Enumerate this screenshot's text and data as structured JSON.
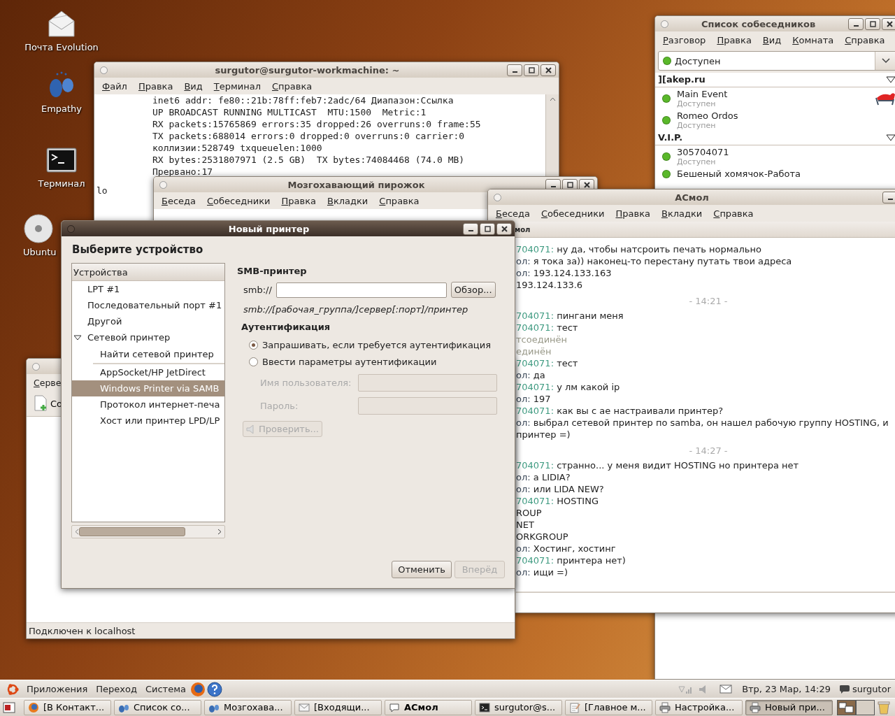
{
  "desktop_icons": [
    {
      "label": "Почта Evolution",
      "kind": "mail"
    },
    {
      "label": "Empathy",
      "kind": "people"
    },
    {
      "label": "Терминал",
      "kind": "terminal"
    },
    {
      "label": "Ubuntu",
      "kind": "disc"
    }
  ],
  "terminal_window": {
    "title": "surgutor@surgutor-workmachine: ~",
    "menu": [
      "Файл",
      "Правка",
      "Вид",
      "Терминал",
      "Справка"
    ],
    "lines": [
      {
        "kind": "detail",
        "text": "inet6 addr: fe80::21b:78ff:feb7:2adc/64 Диапазон:Ссылка"
      },
      {
        "kind": "detail",
        "text": "UP BROADCAST RUNNING MULTICAST  MTU:1500  Metric:1"
      },
      {
        "kind": "detail",
        "text": "RX packets:15765869 errors:35 dropped:26 overruns:0 frame:55"
      },
      {
        "kind": "detail",
        "text": "TX packets:688014 errors:0 dropped:0 overruns:0 carrier:0"
      },
      {
        "kind": "detail",
        "text": "коллизии:528749 txqueuelen:1000"
      },
      {
        "kind": "detail",
        "text": "RX bytes:2531807971 (2.5 GB)  TX bytes:74084468 (74.0 MB)"
      },
      {
        "kind": "detail",
        "text": "Прервано:17"
      },
      {
        "kind": "iface",
        "text": "lo"
      }
    ]
  },
  "contact_list_window": {
    "title": "Список собеседников",
    "menu": [
      "Разговор",
      "Правка",
      "Вид",
      "Комната",
      "Справка"
    ],
    "status": {
      "label": "Доступен",
      "color": "#5ab82a"
    },
    "groups": [
      {
        "name": "][akep.ru",
        "expanded": true,
        "contacts": [
          {
            "name": "Main Event",
            "status": "Доступен",
            "color": "#5ab82a",
            "has_avatar": true
          },
          {
            "name": "Romeo Ordos",
            "status": "Доступен",
            "color": "#5ab82a",
            "has_avatar": false
          }
        ]
      },
      {
        "name": "V.I.P.",
        "expanded": true,
        "contacts": [
          {
            "name": "305704071",
            "status": "Доступен",
            "color": "#5ab82a",
            "has_avatar": false
          },
          {
            "name": "Бешеный хомячок-Работа",
            "color": "#5ab82a",
            "has_avatar": false
          }
        ]
      }
    ]
  },
  "chat_window_1": {
    "title": "Мозгохавающий пирожок",
    "menu": [
      "Беседа",
      "Собеседники",
      "Правка",
      "Вкладки",
      "Справка"
    ]
  },
  "chat_window_2": {
    "title": "АСмол",
    "menu": [
      "Беседа",
      "Собеседники",
      "Правка",
      "Вкладки",
      "Справка"
    ],
    "tab": "мол",
    "messages": [
      {
        "kind": "message",
        "sender": "704071:",
        "color": "#3e9a80",
        "text": "ну да, чтобы натсроить печать нормально"
      },
      {
        "kind": "message",
        "sender": "ол:",
        "color": "#3d4a5a",
        "text": "я тока за)) наконец-то перестану путать твои адреса"
      },
      {
        "kind": "message",
        "sender": "ол:",
        "color": "#3d4a5a",
        "text": "193.124.133.163"
      },
      {
        "kind": "plain",
        "text": "193.124.133.6"
      },
      {
        "kind": "time",
        "text": "- 14:21 -"
      },
      {
        "kind": "message",
        "sender": "704071:",
        "color": "#3e9a80",
        "text": "пингани меня"
      },
      {
        "kind": "message",
        "sender": "704071:",
        "color": "#3e9a80",
        "text": "тест"
      },
      {
        "kind": "system",
        "text": "тсоединён"
      },
      {
        "kind": "system",
        "text": "единён"
      },
      {
        "kind": "message",
        "sender": "704071:",
        "color": "#3e9a80",
        "text": "тест"
      },
      {
        "kind": "message",
        "sender": "ол:",
        "color": "#3d4a5a",
        "text": "да"
      },
      {
        "kind": "message",
        "sender": "704071:",
        "color": "#3e9a80",
        "text": "у лм какой ip"
      },
      {
        "kind": "message",
        "sender": "ол:",
        "color": "#3d4a5a",
        "text": "197"
      },
      {
        "kind": "message",
        "sender": "704071:",
        "color": "#3e9a80",
        "text": "как вы с ае настраивали принтер?"
      },
      {
        "kind": "message",
        "sender": "ол:",
        "color": "#3d4a5a",
        "text": "выбрал сетевой принтер по samba, он нашел рабочую группу  HOSTING, и"
      },
      {
        "kind": "plain",
        "text": "принтер =)"
      },
      {
        "kind": "time",
        "text": "- 14:27 -"
      },
      {
        "kind": "message",
        "sender": "704071:",
        "color": "#3e9a80",
        "text": "странно... у меня видит HOSTING но принтера нет"
      },
      {
        "kind": "message",
        "sender": "ол:",
        "color": "#3d4a5a",
        "text": "а LIDIA?"
      },
      {
        "kind": "message",
        "sender": "ол:",
        "color": "#3d4a5a",
        "text": "или LIDA NEW?"
      },
      {
        "kind": "message",
        "sender": "704071:",
        "color": "#3e9a80",
        "text": "HOSTING"
      },
      {
        "kind": "plain",
        "text": "ROUP"
      },
      {
        "kind": "plain",
        "text": "NET"
      },
      {
        "kind": "plain",
        "text": "ORKGROUP"
      },
      {
        "kind": "message",
        "sender": "ол:",
        "color": "#3d4a5a",
        "text": "Хостинг, хостинг"
      },
      {
        "kind": "message",
        "sender": "704071:",
        "color": "#3e9a80",
        "text": "принтера нет)"
      },
      {
        "kind": "message",
        "sender": "ол:",
        "color": "#3d4a5a",
        "text": "ищи =)"
      }
    ]
  },
  "server_window": {
    "menu": [
      "Серве"
    ],
    "toolbar_button": "Со",
    "status_bar": "Подключен к localhost"
  },
  "printer_dialog": {
    "title": "Новый принтер",
    "heading": "Выберите устройство",
    "list_header": "Устройства",
    "devices": [
      {
        "label": "LPT #1",
        "selected": false
      },
      {
        "label": "Последовательный порт #1",
        "selected": false
      },
      {
        "label": "Другой",
        "selected": false
      },
      {
        "label": "Сетевой принтер",
        "selected": false,
        "expanded": true,
        "children": [
          {
            "label": "Найти сетевой принтер",
            "selected": false,
            "separator_after": true
          },
          {
            "label": "AppSocket/HP JetDirect",
            "selected": false
          },
          {
            "label": "Windows Printer via SAMB",
            "selected": true
          },
          {
            "label": "Протокол интернет-печа",
            "selected": false
          },
          {
            "label": "Хост или принтер LPD/LP",
            "selected": false
          }
        ]
      }
    ],
    "section_title": "SMB-принтер",
    "smb_label": "smb://",
    "browse_button": "Обзор...",
    "hint": "smb://[рабочая_группа/]сервер[:порт]/принтер",
    "auth_title": "Аутентификация",
    "auth_options": [
      {
        "label": "Запрашивать, если требуется аутентификация",
        "selected": true
      },
      {
        "label": "Ввести параметры аутентификации",
        "selected": false
      }
    ],
    "credentials": [
      {
        "label": "Имя пользователя:",
        "disabled": true
      },
      {
        "label": "Пароль:",
        "disabled": true
      }
    ],
    "verify_button": {
      "label": "Проверить...",
      "disabled": true
    },
    "buttons": [
      {
        "label": "Отменить",
        "disabled": false
      },
      {
        "label": "Вперёд",
        "disabled": true
      }
    ]
  },
  "top_panel": {
    "menu": [
      "Приложения",
      "Переход",
      "Система"
    ],
    "clock": "Втр, 23 Мар, 14:29",
    "user": "surgutor"
  },
  "window_list": [
    {
      "label": "[В Контакт...",
      "kind": "browser",
      "selected": false,
      "urgent": false
    },
    {
      "label": "Список со...",
      "kind": "people",
      "selected": false,
      "urgent": false
    },
    {
      "label": "Мозгохава...",
      "kind": "people",
      "selected": false,
      "urgent": false
    },
    {
      "label": "[Входящи...",
      "kind": "mail",
      "selected": false,
      "urgent": false
    },
    {
      "label": "АСмол",
      "kind": "chat",
      "selected": false,
      "urgent": true
    },
    {
      "label": "surgutor@s...",
      "kind": "terminal",
      "selected": false,
      "urgent": false
    },
    {
      "label": "[Главное м...",
      "kind": "note",
      "selected": false,
      "urgent": false
    },
    {
      "label": "Настройка...",
      "kind": "printer",
      "selected": false,
      "urgent": false
    },
    {
      "label": "Новый при...",
      "kind": "printer",
      "selected": true,
      "urgent": false
    }
  ]
}
